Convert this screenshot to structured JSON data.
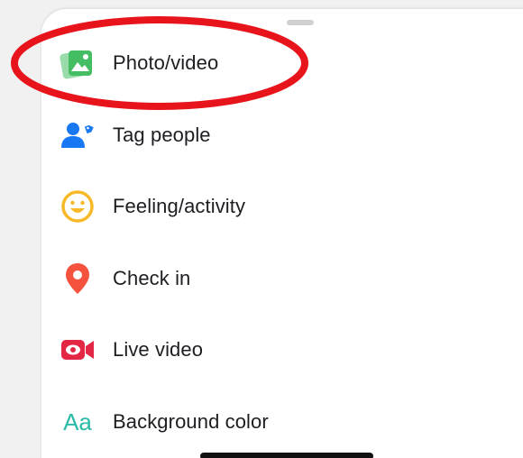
{
  "menu": {
    "items": [
      {
        "label": "Photo/video",
        "icon": "photo-video-icon",
        "color": "#45bd62"
      },
      {
        "label": "Tag people",
        "icon": "tag-people-icon",
        "color": "#1877f2"
      },
      {
        "label": "Feeling/activity",
        "icon": "feeling-activity-icon",
        "color": "#f7b928"
      },
      {
        "label": "Check in",
        "icon": "check-in-icon",
        "color": "#f5533d"
      },
      {
        "label": "Live video",
        "icon": "live-video-icon",
        "color": "#e42645"
      },
      {
        "label": "Background color",
        "icon": "background-color-icon",
        "glyph": "Aa",
        "color": "#2abba7"
      }
    ]
  },
  "annotation": {
    "highlight_color": "#e8141b"
  }
}
